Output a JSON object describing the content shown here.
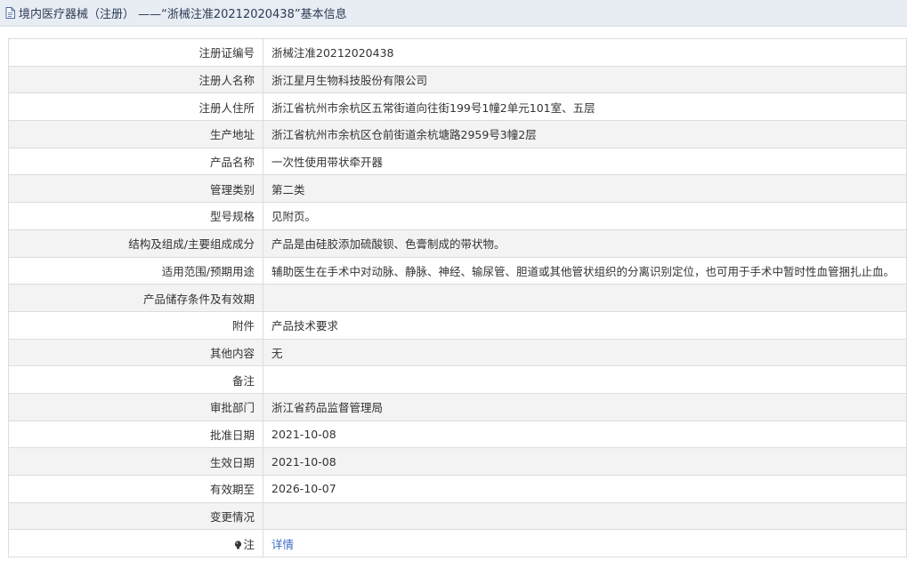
{
  "header": {
    "title": "境内医疗器械（注册） ——“浙械注准20212020438”基本信息"
  },
  "rows": [
    {
      "label": "注册证编号",
      "value": "浙械注准20212020438"
    },
    {
      "label": "注册人名称",
      "value": "浙江星月生物科技股份有限公司"
    },
    {
      "label": "注册人住所",
      "value": "浙江省杭州市余杭区五常街道向往街199号1幢2单元101室、五层"
    },
    {
      "label": "生产地址",
      "value": "浙江省杭州市余杭区仓前街道余杭塘路2959号3幢2层"
    },
    {
      "label": "产品名称",
      "value": "一次性使用带状牵开器"
    },
    {
      "label": "管理类别",
      "value": "第二类"
    },
    {
      "label": "型号规格",
      "value": "见附页。"
    },
    {
      "label": "结构及组成/主要组成成分",
      "value": "产品是由硅胶添加硫酸钡、色膏制成的带状物。"
    },
    {
      "label": "适用范围/预期用途",
      "value": "辅助医生在手术中对动脉、静脉、神经、输尿管、胆道或其他管状组织的分离识别定位，也可用于手术中暂时性血管捆扎止血。"
    },
    {
      "label": "产品储存条件及有效期",
      "value": ""
    },
    {
      "label": "附件",
      "value": "产品技术要求"
    },
    {
      "label": "其他内容",
      "value": "无"
    },
    {
      "label": "备注",
      "value": ""
    },
    {
      "label": "审批部门",
      "value": "浙江省药品监督管理局"
    },
    {
      "label": "批准日期",
      "value": "2021-10-08"
    },
    {
      "label": "生效日期",
      "value": "2021-10-08"
    },
    {
      "label": "有效期至",
      "value": "2026-10-07"
    },
    {
      "label": "变更情况",
      "value": ""
    }
  ],
  "note_row": {
    "label": "注",
    "link": "详情",
    "icon": "bulb-icon"
  },
  "colors": {
    "header_bg": "#e8ecf3",
    "row_alt_bg": "#f3f3f3",
    "border": "#dcdcdc",
    "link": "#3a6bc4"
  }
}
